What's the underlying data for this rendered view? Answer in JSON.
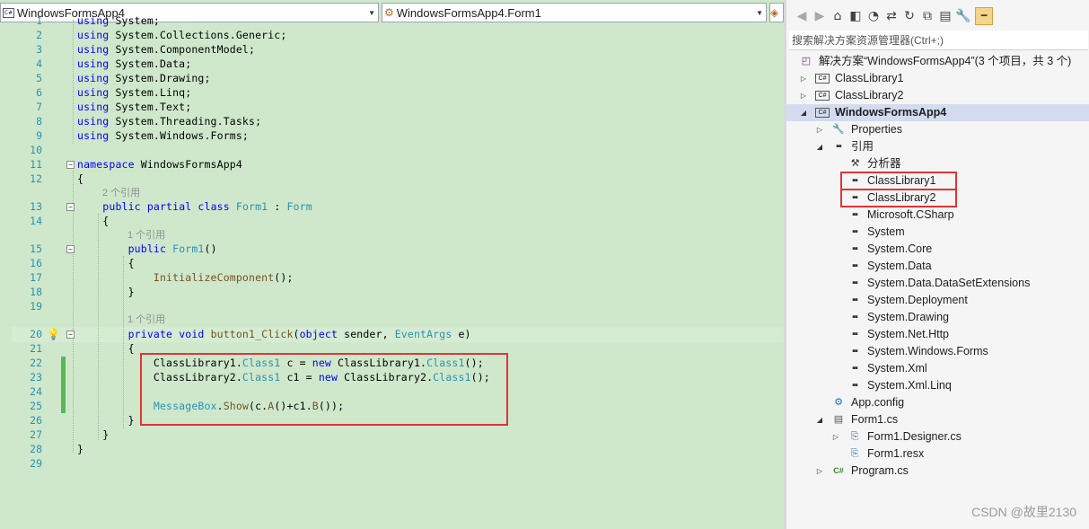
{
  "editor": {
    "project_combo": "WindowsFormsApp4",
    "class_combo": "WindowsFormsApp4.Form1",
    "lines": [
      {
        "num": "1",
        "code": "using System;"
      },
      {
        "num": "2",
        "code": "using System.Collections.Generic;"
      },
      {
        "num": "3",
        "code": "using System.ComponentModel;"
      },
      {
        "num": "4",
        "code": "using System.Data;"
      },
      {
        "num": "5",
        "code": "using System.Drawing;"
      },
      {
        "num": "6",
        "code": "using System.Linq;"
      },
      {
        "num": "7",
        "code": "using System.Text;"
      },
      {
        "num": "8",
        "code": "using System.Threading.Tasks;"
      },
      {
        "num": "9",
        "code": "using System.Windows.Forms;"
      },
      {
        "num": "10",
        "code": ""
      },
      {
        "num": "11",
        "code": "namespace WindowsFormsApp4"
      },
      {
        "num": "12",
        "code": "{"
      },
      {
        "num": "13",
        "code": "    public partial class Form1 : Form"
      },
      {
        "num": "14",
        "code": "    {"
      },
      {
        "num": "15",
        "code": "        public Form1()"
      },
      {
        "num": "16",
        "code": "        {"
      },
      {
        "num": "17",
        "code": "            InitializeComponent();"
      },
      {
        "num": "18",
        "code": "        }"
      },
      {
        "num": "19",
        "code": ""
      },
      {
        "num": "20",
        "code": "        private void button1_Click(object sender, EventArgs e)"
      },
      {
        "num": "21",
        "code": "        {"
      },
      {
        "num": "22",
        "code": "            ClassLibrary1.Class1 c = new ClassLibrary1.Class1();"
      },
      {
        "num": "23",
        "code": "            ClassLibrary2.Class1 c1 = new ClassLibrary2.Class1();"
      },
      {
        "num": "24",
        "code": ""
      },
      {
        "num": "25",
        "code": "            MessageBox.Show(c.A()+c1.B());"
      },
      {
        "num": "26",
        "code": "        }"
      },
      {
        "num": "27",
        "code": "    }"
      },
      {
        "num": "28",
        "code": "}"
      },
      {
        "num": "29",
        "code": ""
      }
    ],
    "codelens": {
      "class_refs": "2 个引用",
      "ctor_refs": "1 个引用",
      "method_refs": "1 个引用"
    }
  },
  "solution_explorer": {
    "search_placeholder": "搜索解决方案资源管理器(Ctrl+;)",
    "solution_label": "解决方案“WindowsFormsApp4”(3 个项目，共 3 个)",
    "nodes": [
      {
        "label": "ClassLibrary1",
        "icon": "csharp-project-icon"
      },
      {
        "label": "ClassLibrary2",
        "icon": "csharp-project-icon"
      },
      {
        "label": "WindowsFormsApp4",
        "icon": "csharp-project-icon"
      },
      {
        "label": "Properties",
        "icon": "wrench-icon"
      },
      {
        "label": "引用",
        "icon": "reference-icon"
      },
      {
        "label": "分析器",
        "icon": "analyzer-icon"
      },
      {
        "label": "ClassLibrary1",
        "icon": "reference-icon"
      },
      {
        "label": "ClassLibrary2",
        "icon": "reference-icon"
      },
      {
        "label": "Microsoft.CSharp",
        "icon": "reference-icon"
      },
      {
        "label": "System",
        "icon": "reference-icon"
      },
      {
        "label": "System.Core",
        "icon": "reference-icon"
      },
      {
        "label": "System.Data",
        "icon": "reference-icon"
      },
      {
        "label": "System.Data.DataSetExtensions",
        "icon": "reference-icon"
      },
      {
        "label": "System.Deployment",
        "icon": "reference-icon"
      },
      {
        "label": "System.Drawing",
        "icon": "reference-icon"
      },
      {
        "label": "System.Net.Http",
        "icon": "reference-icon"
      },
      {
        "label": "System.Windows.Forms",
        "icon": "reference-icon"
      },
      {
        "label": "System.Xml",
        "icon": "reference-icon"
      },
      {
        "label": "System.Xml.Linq",
        "icon": "reference-icon"
      },
      {
        "label": "App.config",
        "icon": "config-file-icon"
      },
      {
        "label": "Form1.cs",
        "icon": "form-icon"
      },
      {
        "label": "Form1.Designer.cs",
        "icon": "code-file-icon"
      },
      {
        "label": "Form1.resx",
        "icon": "resource-file-icon"
      },
      {
        "label": "Program.cs",
        "icon": "csharp-file-icon"
      }
    ]
  },
  "watermark": "CSDN @故里2130",
  "colors": {
    "editor_background": "#cfe8cc",
    "keyword": "#0000ff",
    "type": "#2b91af",
    "highlight_box": "#e03535",
    "selection": "#d3dcef"
  }
}
